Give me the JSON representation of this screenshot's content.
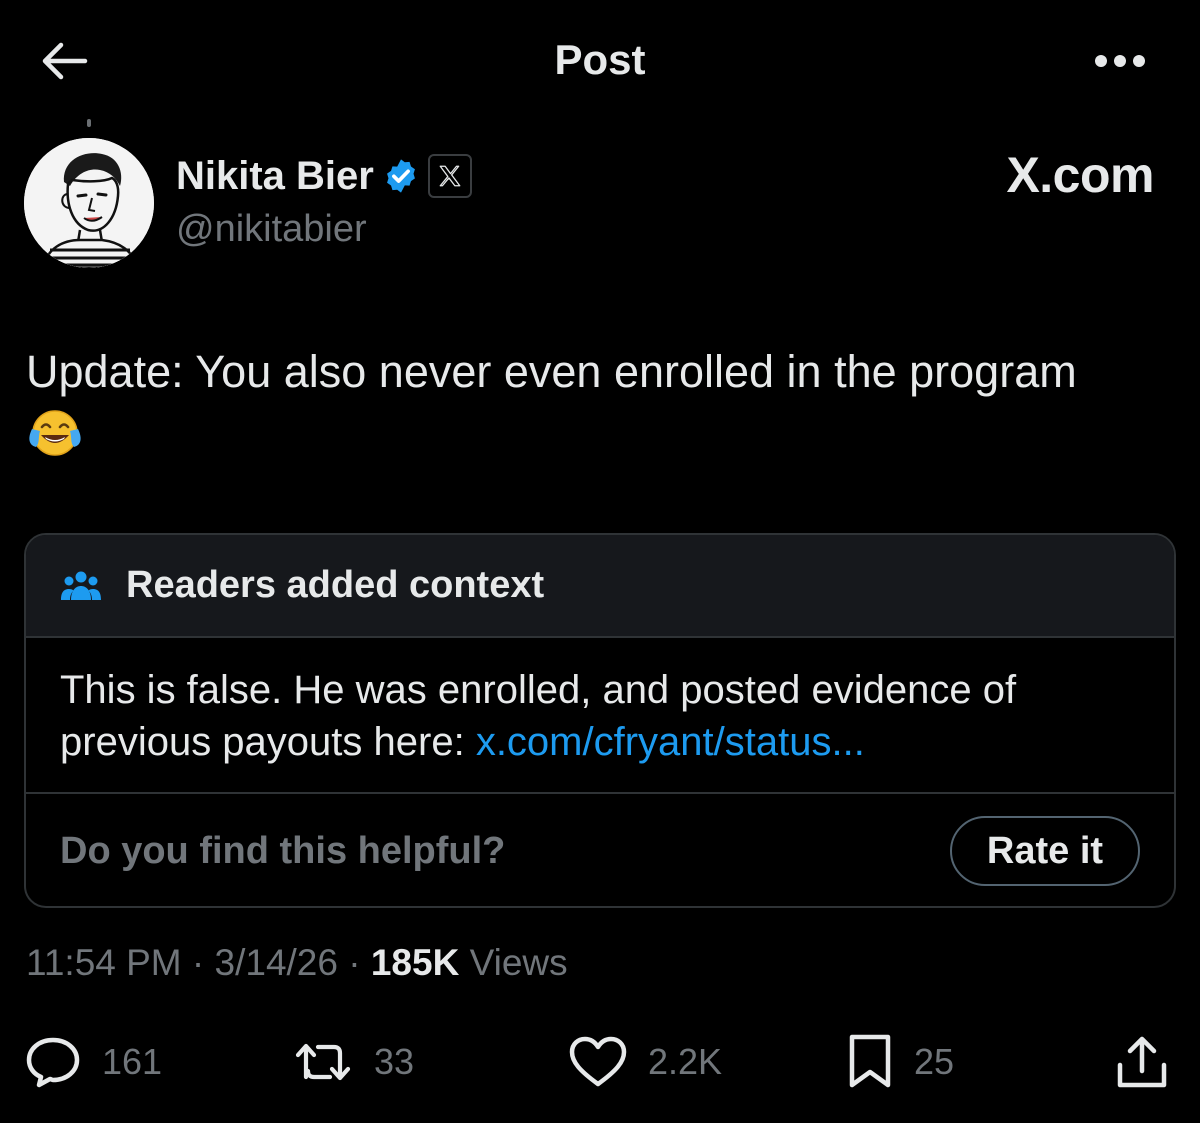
{
  "header": {
    "title": "Post",
    "back_icon": "arrow-left-icon",
    "more_icon": "more-horizontal-icon"
  },
  "author": {
    "name": "Nikita Bier",
    "handle": "@nikitabier",
    "affiliation": "X.com",
    "verified_color": "#1d9bf0"
  },
  "post": {
    "text": "Update: You also never even enrolled in the program",
    "emoji": "face-with-tears-of-joy"
  },
  "community_note": {
    "header": "Readers added context",
    "body_prefix": "This is false. He was enrolled, and posted evidence of previous payouts here: ",
    "link_text": "x.com/cfryant/status...",
    "question": "Do you find this helpful?",
    "rate_label": "Rate it",
    "accent_color": "#1d9bf0"
  },
  "meta": {
    "time": "11:54 PM",
    "sep1": " · ",
    "date": "3/14/26",
    "sep2": " · ",
    "views_count": "185K",
    "views_label": " Views"
  },
  "actions": {
    "replies": "161",
    "reposts": "33",
    "likes": "2.2K",
    "bookmarks": "25"
  }
}
